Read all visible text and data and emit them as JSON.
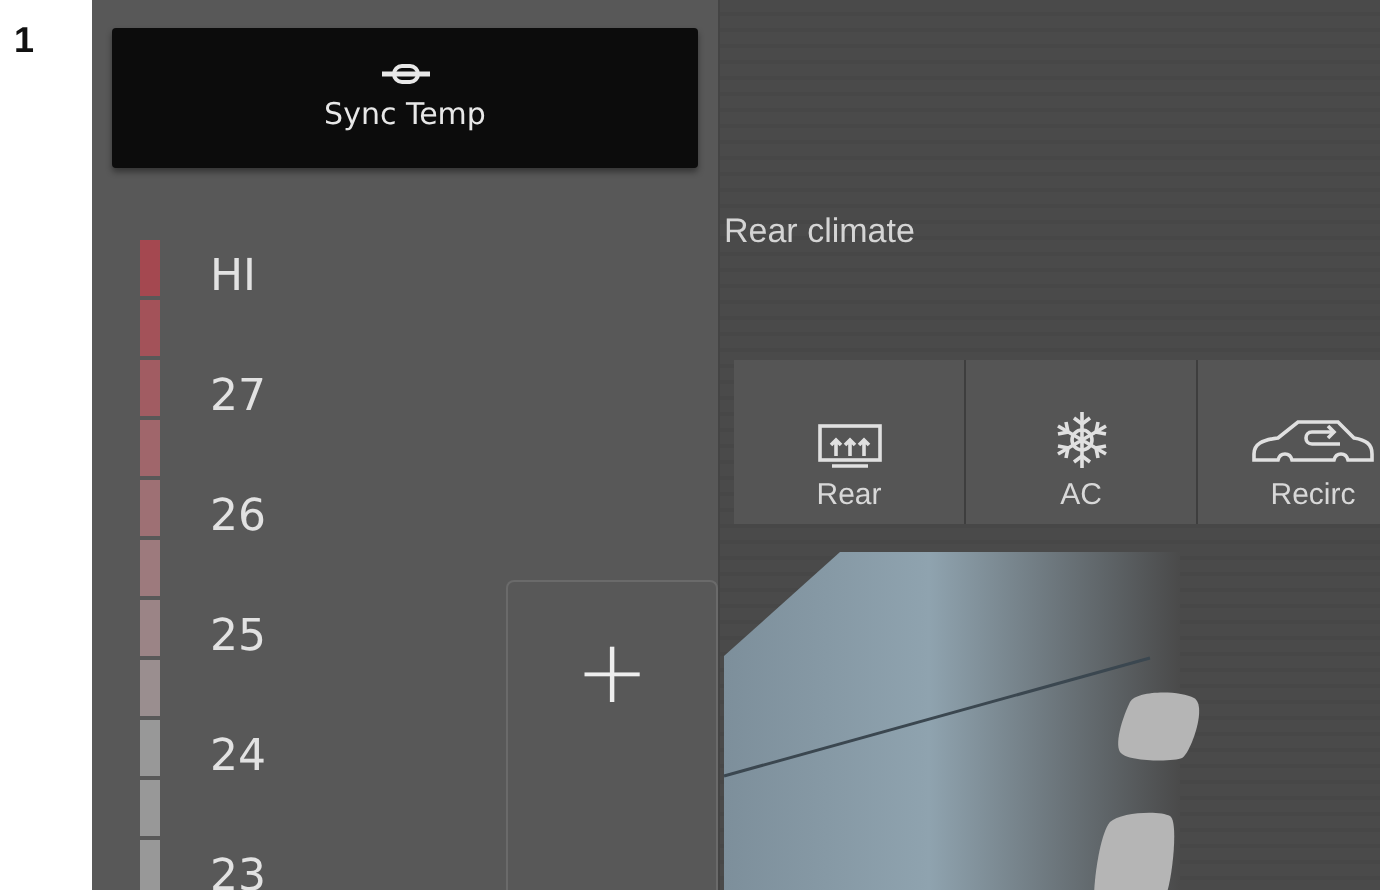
{
  "figure_number": "1",
  "sync_button": {
    "label": "Sync Temp"
  },
  "temperature_scale": [
    "HI",
    "27",
    "26",
    "25",
    "24",
    "23"
  ],
  "plus_button": {
    "label": "+"
  },
  "rear_panel": {
    "title": "Rear climate",
    "buttons": [
      {
        "kind": "rear-defrost",
        "label": "Rear"
      },
      {
        "kind": "ac",
        "label": "AC"
      },
      {
        "kind": "recirc",
        "label": "Recirc"
      }
    ]
  }
}
